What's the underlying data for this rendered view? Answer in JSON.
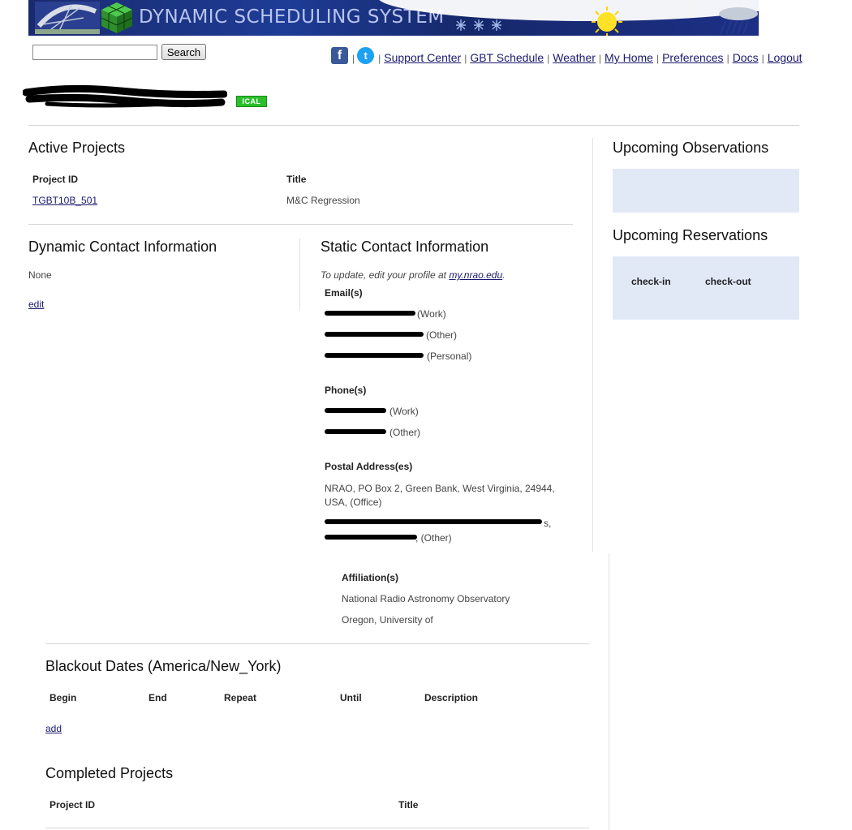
{
  "header": {
    "system_title": "DYNAMIC SCHEDULING SYSTEM"
  },
  "search": {
    "value": "",
    "button_label": "Search"
  },
  "nav": {
    "links": [
      "Support Center",
      "GBT Schedule",
      "Weather",
      "My Home",
      "Preferences",
      "Docs",
      "Logout"
    ]
  },
  "user": {
    "ical_label": "ICAL"
  },
  "active_projects": {
    "heading": "Active Projects",
    "columns": [
      "Project ID",
      "Title"
    ],
    "rows": [
      {
        "project_id": "TGBT10B_501",
        "title": "M&C Regression"
      }
    ]
  },
  "dynamic_contact": {
    "heading": "Dynamic Contact Information",
    "value": "None",
    "edit_label": "edit"
  },
  "static_contact": {
    "heading": "Static Contact Information",
    "note_prefix": "To update, edit your profile at ",
    "note_link": "my.nrao.edu",
    "note_suffix": ".",
    "emails_label": "Email(s)",
    "emails": [
      "(Work)",
      "(Other)",
      "(Personal)"
    ],
    "phones_label": "Phone(s)",
    "phones": [
      "(Work)",
      "(Other)"
    ],
    "postal_label": "Postal Address(es)",
    "postal_office_line1": "NRAO, PO Box 2, Green Bank, West Virginia, 24944,",
    "postal_office_line2": "USA, (Office)",
    "postal_other_suffix1": "s,",
    "postal_other_suffix2": ", (Other)",
    "affiliations_label": "Affiliation(s)",
    "affiliations": [
      "National Radio Astronomy Observatory",
      "Oregon, University of"
    ]
  },
  "upcoming_observations": {
    "heading": "Upcoming Observations"
  },
  "upcoming_reservations": {
    "heading": "Upcoming Reservations",
    "columns": [
      "check-in",
      "check-out"
    ]
  },
  "blackout": {
    "heading": "Blackout Dates (America/New_York)",
    "columns": [
      "Begin",
      "End",
      "Repeat",
      "Until",
      "Description"
    ],
    "add_label": "add"
  },
  "completed_projects": {
    "heading": "Completed Projects",
    "columns": [
      "Project ID",
      "Title"
    ]
  },
  "colors": {
    "banner": "#1e3c96",
    "panel": "#e1e9f7",
    "ical": "#2bbf2b",
    "link": "#1a1a6e"
  }
}
